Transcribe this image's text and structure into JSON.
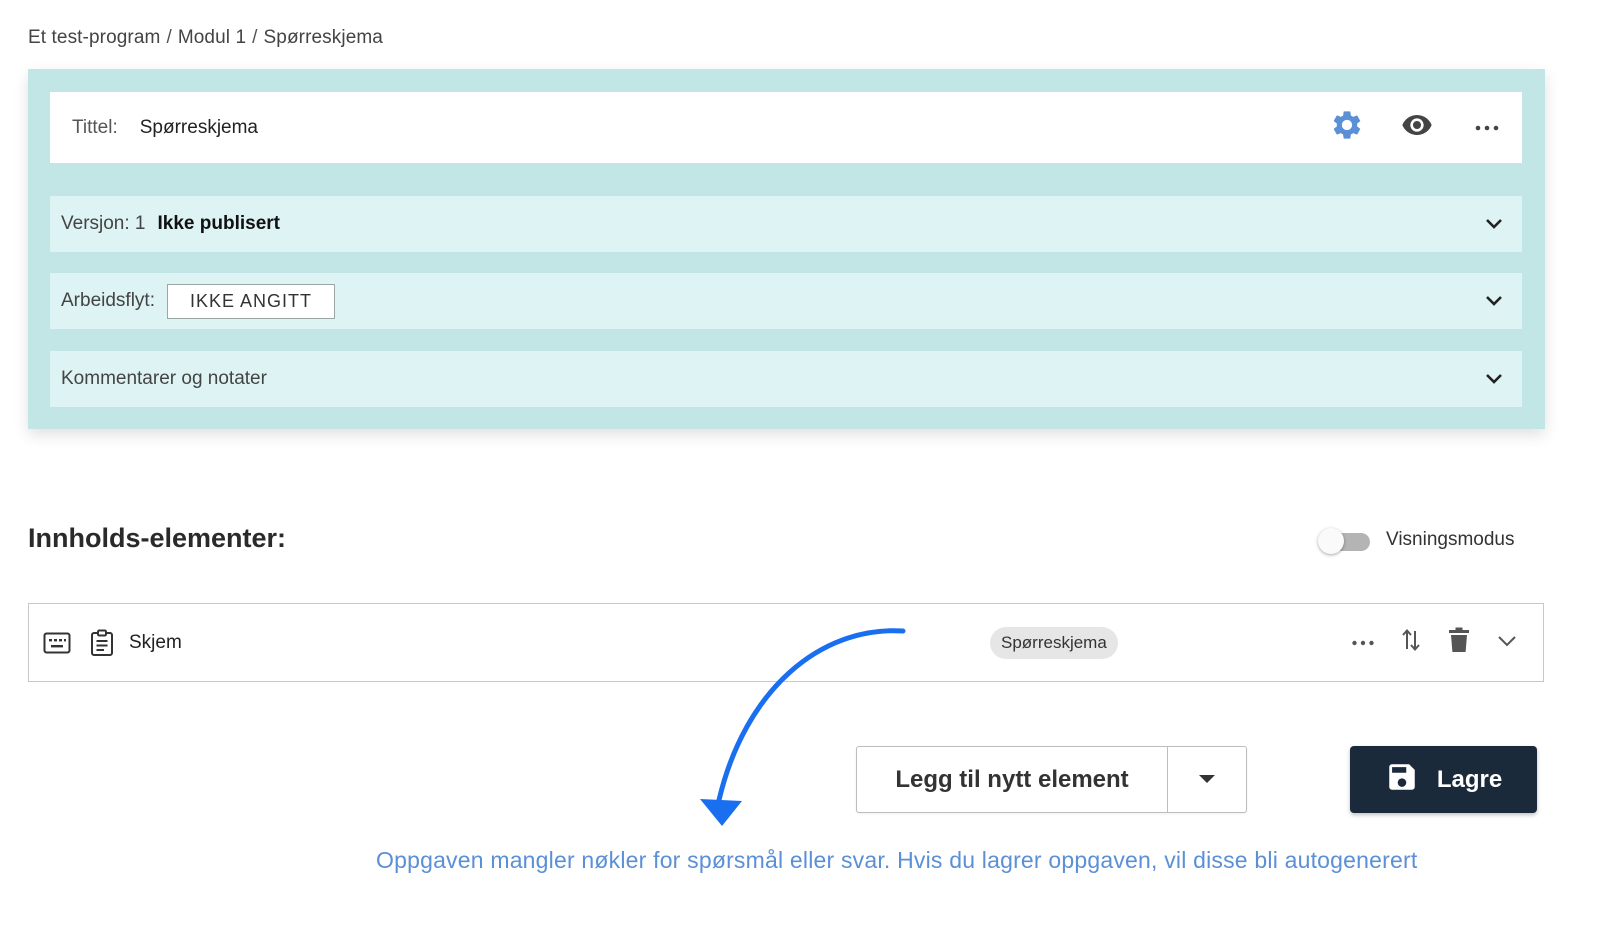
{
  "breadcrumb": {
    "items": [
      "Et test-program",
      "Modul 1",
      "Spørreskjema"
    ],
    "separator": "/"
  },
  "header": {
    "title_label": "Tittel:",
    "title_value": "Spørreskjema",
    "icons": [
      "gear-icon",
      "eye-icon",
      "more-horizontal-icon"
    ]
  },
  "version": {
    "label": "Versjon: 1",
    "status": "Ikke publisert"
  },
  "workflow": {
    "label": "Arbeidsflyt:",
    "value": "IKKE ANGITT"
  },
  "comments": {
    "label": "Kommentarer og notater"
  },
  "content": {
    "title": "Innholds-elementer:",
    "view_mode_label": "Visningsmodus",
    "view_mode_on": false
  },
  "element": {
    "name": "Skjem",
    "type_chip": "Spørreskjema",
    "icons": [
      "keyboard-icon",
      "clipboard-icon",
      "more-horizontal-icon",
      "reorder-icon",
      "trash-icon",
      "chevron-down-icon"
    ]
  },
  "actions": {
    "add_label": "Legg til nytt element",
    "save_label": "Lagre"
  },
  "warning": {
    "text": "Oppgaven mangler nøkler for spørsmål eller svar. Hvis du lagrer oppgaven, vil disse bli autogenerert"
  },
  "colors": {
    "panel_bg": "#c2e6e6",
    "row_bg": "#def3f3",
    "gear": "#5b8fd6",
    "save_bg": "#1b2a3b",
    "arrow": "#1a6ff0",
    "warning_text": "#5b8fd6"
  }
}
